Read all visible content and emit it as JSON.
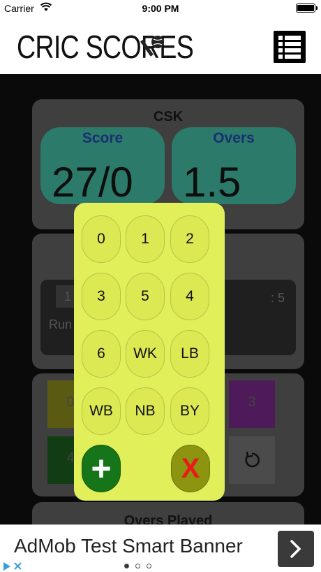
{
  "status_bar": {
    "carrier": "Carrier",
    "time": "9:00 PM"
  },
  "header": {
    "logo_text": "CRIC SCORES",
    "logo_icon": "cricket-bat-ball-icon",
    "menu_icon": "list-menu-icon"
  },
  "scoreboard": {
    "team": "CSK",
    "score_label": "Score",
    "score_value": "27/0",
    "overs_label": "Overs",
    "overs_value": "1.5"
  },
  "partial_background": {
    "chip_text": "1",
    "runs_label": "Run",
    "ratio_text": ": 5",
    "tile_left_top": "0",
    "tile_left_bottom": "4",
    "tile_right_top": "3",
    "overs_played_label": "Overs Played"
  },
  "keypad": {
    "keys": [
      "0",
      "1",
      "2",
      "3",
      "5",
      "4",
      "6",
      "WK",
      "LB",
      "WB",
      "NB",
      "BY"
    ],
    "add_label": "+",
    "cancel_label": "X"
  },
  "ad": {
    "text": "AdMob Test Smart Banner",
    "next_icon": "chevron-right-icon",
    "choices_icon": "adchoices-icon"
  },
  "colors": {
    "keypad_bg": "#e0ef5a",
    "add_button": "#177519",
    "cancel_button": "#8c9410",
    "cancel_x": "#e81b1b",
    "pill": "#2b7a6a",
    "pill_label": "#1a2f72"
  }
}
